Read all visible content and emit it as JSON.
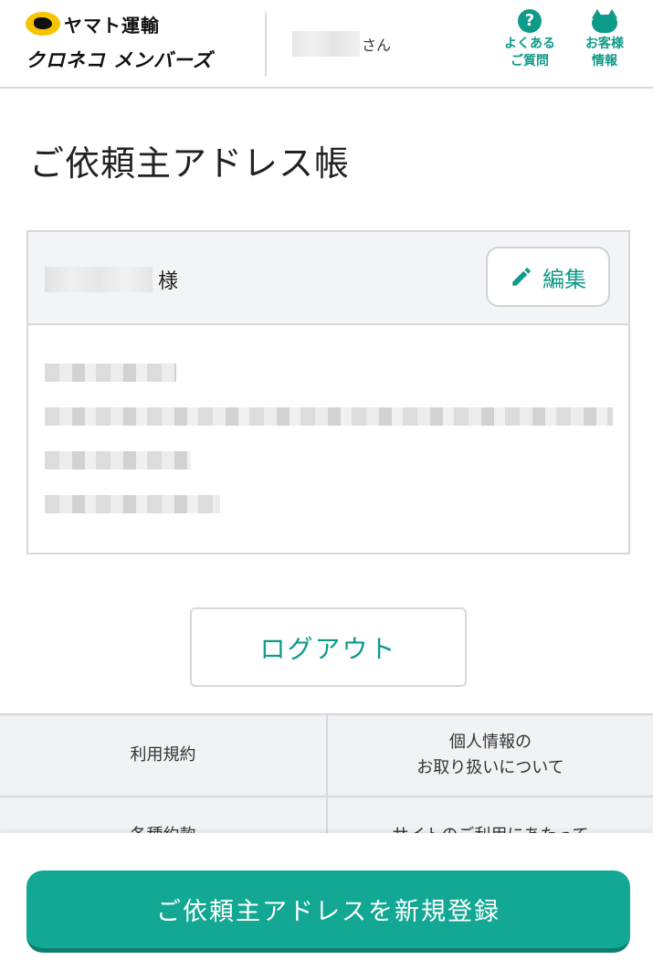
{
  "header": {
    "brand_name": "ヤマト運輸",
    "brand_sub": "クロネコ メンバーズ",
    "user_suffix": "さん",
    "faq_label": "よくある\nご質問",
    "faq_line1": "よくある",
    "faq_line2": "ご質問",
    "account_line1": "お客様",
    "account_line2": "情報",
    "faq_icon": "question-circle-icon",
    "account_icon": "cat-icon"
  },
  "page": {
    "title": "ご依頼主アドレス帳"
  },
  "address_card": {
    "honorific": "様",
    "edit_label": "編集",
    "edit_icon": "pencil-icon"
  },
  "actions": {
    "logout_label": "ログアウト",
    "register_label": "ご依頼主アドレスを新規登録"
  },
  "footer": {
    "terms_label": "利用規約",
    "privacy_line1": "個人情報の",
    "privacy_line2": "お取り扱いについて",
    "agreements_label": "各種約款",
    "site_usage_label": "サイトのご利用にあたって"
  },
  "colors": {
    "accent": "#0e9a88",
    "button": "#12a894",
    "border": "#d5d8dc",
    "card_head_bg": "#f3f4f6"
  }
}
